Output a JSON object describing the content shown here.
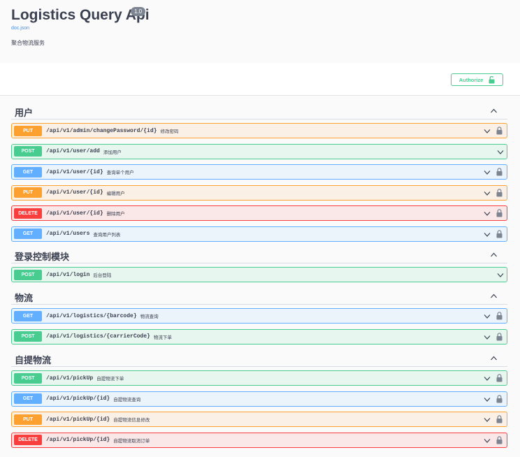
{
  "info": {
    "title": "Logistics Query Api",
    "version": "1.0",
    "doc_link": "doc.json",
    "description": "聚合物流服务"
  },
  "authorize": {
    "label": "Authorize"
  },
  "colors": {
    "put": "#fca130",
    "post": "#49cc90",
    "get": "#61affe",
    "delete": "#f93e3e"
  },
  "tags": [
    {
      "name": "用户",
      "ops": [
        {
          "method": "PUT",
          "path": "/api/v1/admin/changePassword/{id}",
          "summary": "修改密码",
          "locked": true
        },
        {
          "method": "POST",
          "path": "/api/v1/user/add",
          "summary": "添加用户",
          "locked": false
        },
        {
          "method": "GET",
          "path": "/api/v1/user/{id}",
          "summary": "查询单个用户",
          "locked": true
        },
        {
          "method": "PUT",
          "path": "/api/v1/user/{id}",
          "summary": "编辑用户",
          "locked": true
        },
        {
          "method": "DELETE",
          "path": "/api/v1/user/{id}",
          "summary": "删除用户",
          "locked": true
        },
        {
          "method": "GET",
          "path": "/api/v1/users",
          "summary": "查询用户列表",
          "locked": true
        }
      ]
    },
    {
      "name": "登录控制模块",
      "ops": [
        {
          "method": "POST",
          "path": "/api/v1/login",
          "summary": "后台登陆",
          "locked": false
        }
      ]
    },
    {
      "name": "物流",
      "ops": [
        {
          "method": "GET",
          "path": "/api/v1/logistics/{barcode}",
          "summary": "物流查询",
          "locked": true
        },
        {
          "method": "POST",
          "path": "/api/v1/logistics/{carrierCode}",
          "summary": "物流下单",
          "locked": true
        }
      ]
    },
    {
      "name": "自提物流",
      "ops": [
        {
          "method": "POST",
          "path": "/api/v1/pickUp",
          "summary": "自提物流下单",
          "locked": true
        },
        {
          "method": "GET",
          "path": "/api/v1/pickUp/{id}",
          "summary": "自提物流查询",
          "locked": true
        },
        {
          "method": "PUT",
          "path": "/api/v1/pickUp/{id}",
          "summary": "自提物流信息修改",
          "locked": true
        },
        {
          "method": "DELETE",
          "path": "/api/v1/pickUp/{id}",
          "summary": "自提物流取消订单",
          "locked": true
        }
      ]
    }
  ]
}
